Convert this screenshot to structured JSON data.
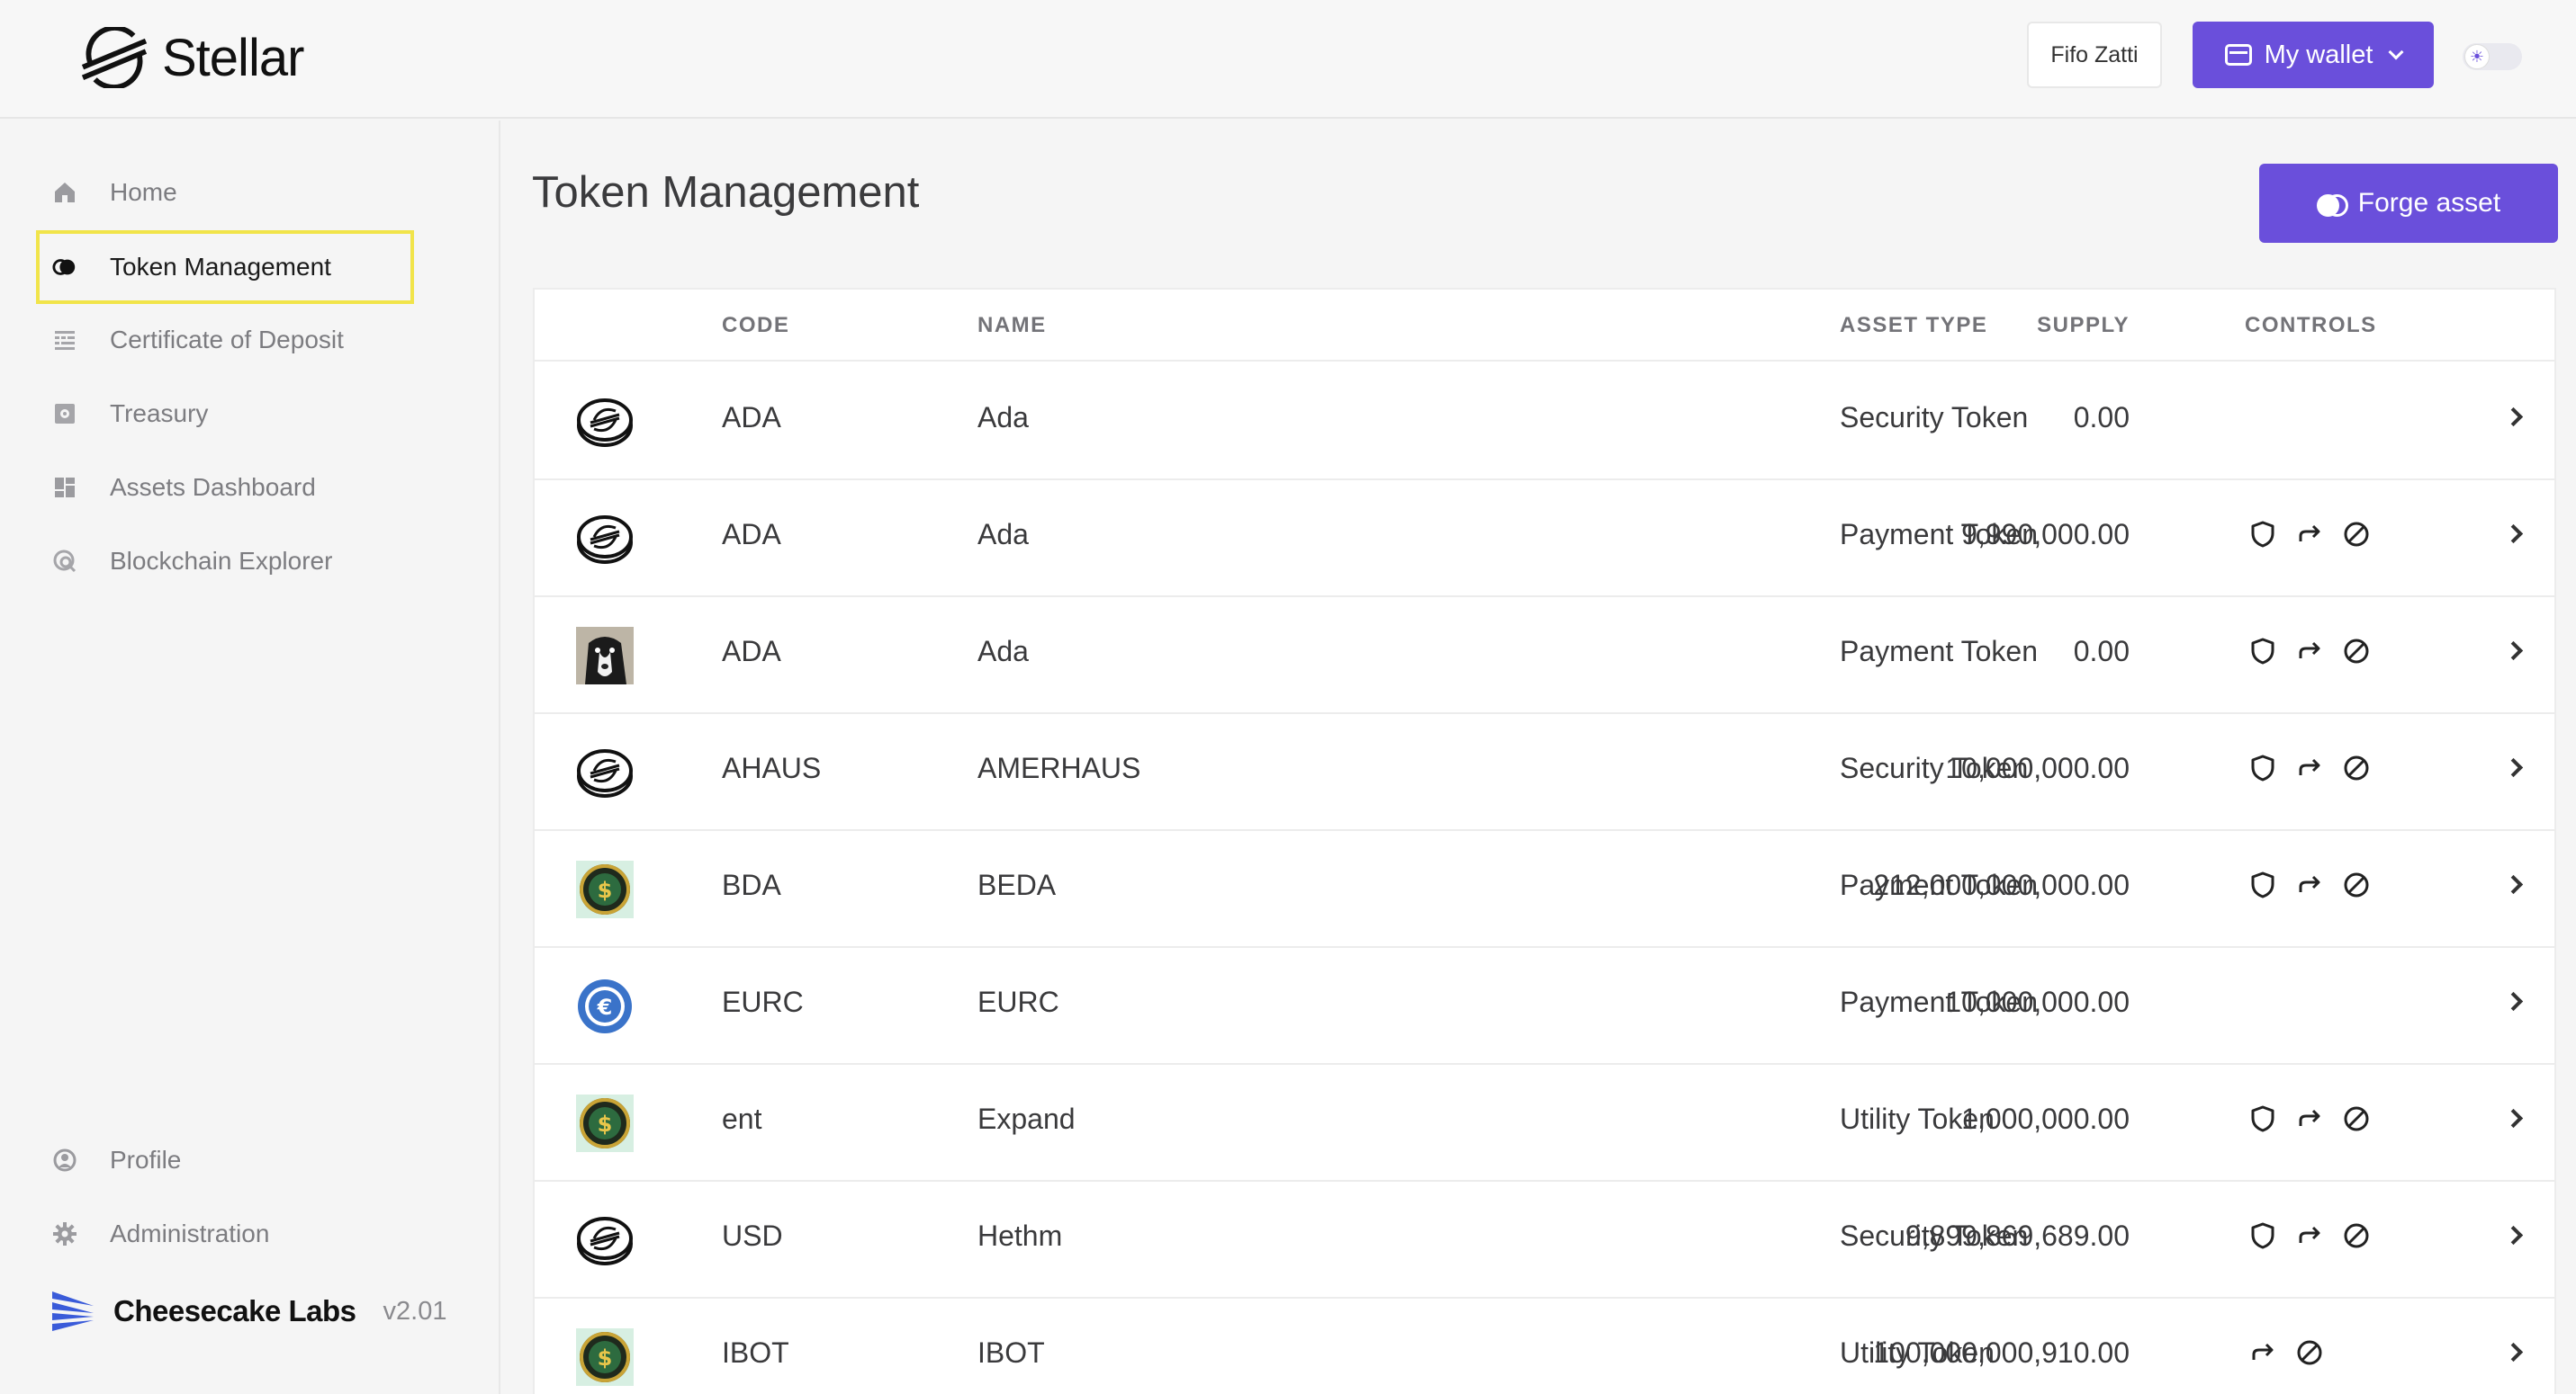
{
  "header": {
    "logo_text": "Stellar",
    "user_name": "Fifo Zatti",
    "wallet_label": "My wallet"
  },
  "sidebar": {
    "items": [
      {
        "label": "Home",
        "icon": "home-icon"
      },
      {
        "label": "Token Management",
        "icon": "token-icon",
        "active": true
      },
      {
        "label": "Certificate of Deposit",
        "icon": "certificate-icon"
      },
      {
        "label": "Treasury",
        "icon": "vault-icon"
      },
      {
        "label": "Assets Dashboard",
        "icon": "dashboard-icon"
      },
      {
        "label": "Blockchain Explorer",
        "icon": "explorer-icon"
      }
    ],
    "bottom_items": [
      {
        "label": "Profile",
        "icon": "user-circle-icon"
      },
      {
        "label": "Administration",
        "icon": "gear-icon"
      }
    ],
    "brand_name": "Cheesecake Labs",
    "version": "v2.01"
  },
  "main": {
    "title": "Token Management",
    "forge_label": "Forge asset"
  },
  "table": {
    "columns": {
      "code": "CODE",
      "name": "NAME",
      "supply": "SUPPLY",
      "asset_type": "ASSET TYPE",
      "controls": "CONTROLS"
    },
    "rows": [
      {
        "icon": "stellar-coin-icon",
        "code": "ADA",
        "name": "Ada",
        "supply": "0.00",
        "asset_type": "Security Token",
        "controls": []
      },
      {
        "icon": "stellar-coin-icon",
        "code": "ADA",
        "name": "Ada",
        "supply": "9,990,000.00",
        "asset_type": "Payment Token",
        "controls": [
          "shield-icon",
          "transfer-icon",
          "block-icon"
        ]
      },
      {
        "icon": "dog-photo-icon",
        "code": "ADA",
        "name": "Ada",
        "supply": "0.00",
        "asset_type": "Payment Token",
        "controls": [
          "shield-icon",
          "transfer-icon",
          "block-icon"
        ]
      },
      {
        "icon": "stellar-coin-icon",
        "code": "AHAUS",
        "name": "AMERHAUS",
        "supply": "10,000,000.00",
        "asset_type": "Security Token",
        "controls": [
          "shield-icon",
          "transfer-icon",
          "block-icon"
        ]
      },
      {
        "icon": "dollar-coin-icon",
        "code": "BDA",
        "name": "BEDA",
        "supply": "212,000,000,000.00",
        "asset_type": "Payment Token",
        "controls": [
          "shield-icon",
          "transfer-icon",
          "block-icon"
        ]
      },
      {
        "icon": "euro-coin-icon",
        "code": "EURC",
        "name": "EURC",
        "supply": "10,000,000.00",
        "asset_type": "Payment Token",
        "controls": []
      },
      {
        "icon": "dollar-coin-icon",
        "code": "ent",
        "name": "Expand",
        "supply": "1,000,000.00",
        "asset_type": "Utility Token",
        "controls": [
          "shield-icon",
          "transfer-icon",
          "block-icon"
        ]
      },
      {
        "icon": "stellar-coin-icon",
        "code": "USD",
        "name": "Hethm",
        "supply": "9,899,869,689.00",
        "asset_type": "Security Token",
        "controls": [
          "shield-icon",
          "transfer-icon",
          "block-icon"
        ]
      },
      {
        "icon": "dollar-coin-icon",
        "code": "IBOT",
        "name": "IBOT",
        "supply": "100,000,000,910.00",
        "asset_type": "Utility Token",
        "controls": [
          "transfer-icon",
          "block-icon"
        ]
      }
    ]
  },
  "colors": {
    "accent": "#6a4fdb",
    "active_outline": "#f1e44a"
  }
}
